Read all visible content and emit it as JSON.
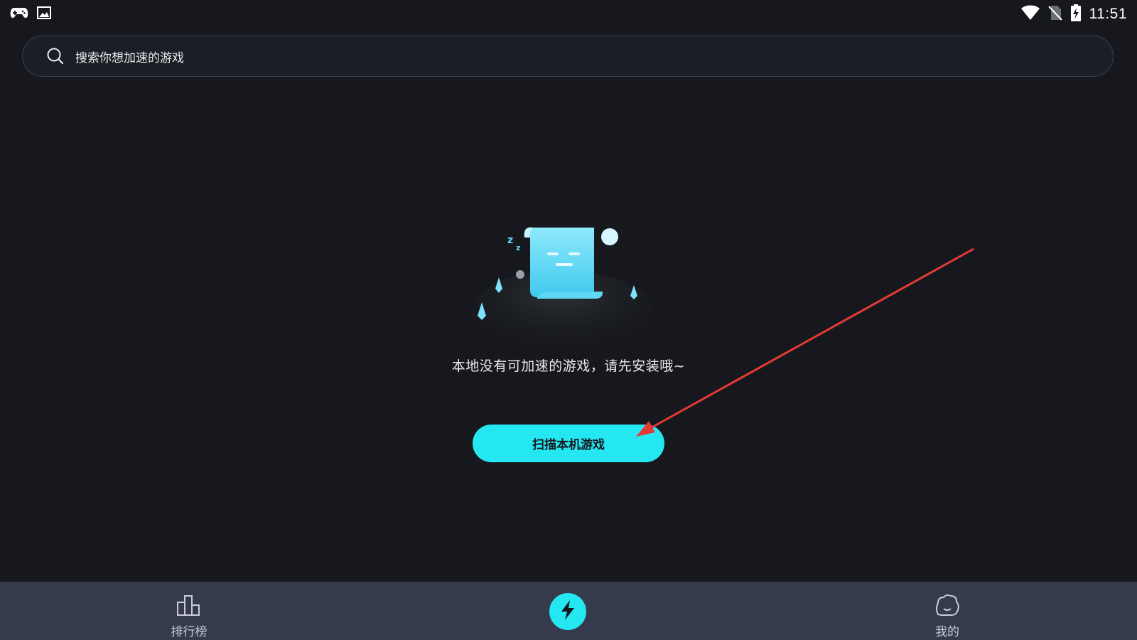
{
  "status_bar": {
    "time": "11:51",
    "left_icons": [
      "gamepad-icon",
      "image-icon"
    ],
    "right_icons": [
      "wifi-icon",
      "no-sim-icon",
      "battery-charging-icon"
    ]
  },
  "search": {
    "placeholder": "搜索你想加速的游戏",
    "icon": "search-icon"
  },
  "empty_state": {
    "message": "本地没有可加速的游戏，请先安装哦~",
    "illustration": "sleeping-scroll-illustration",
    "scan_button_label": "扫描本机游戏"
  },
  "bottom_nav": {
    "items": [
      {
        "label": "排行榜",
        "icon": "ranking-icon"
      },
      {
        "label": "",
        "icon": "lightning-icon"
      },
      {
        "label": "我的",
        "icon": "profile-icon"
      }
    ]
  },
  "colors": {
    "background": "#16181d",
    "accent": "#25e7f2",
    "nav_background": "#353b4c",
    "annotation": "#e53935"
  }
}
